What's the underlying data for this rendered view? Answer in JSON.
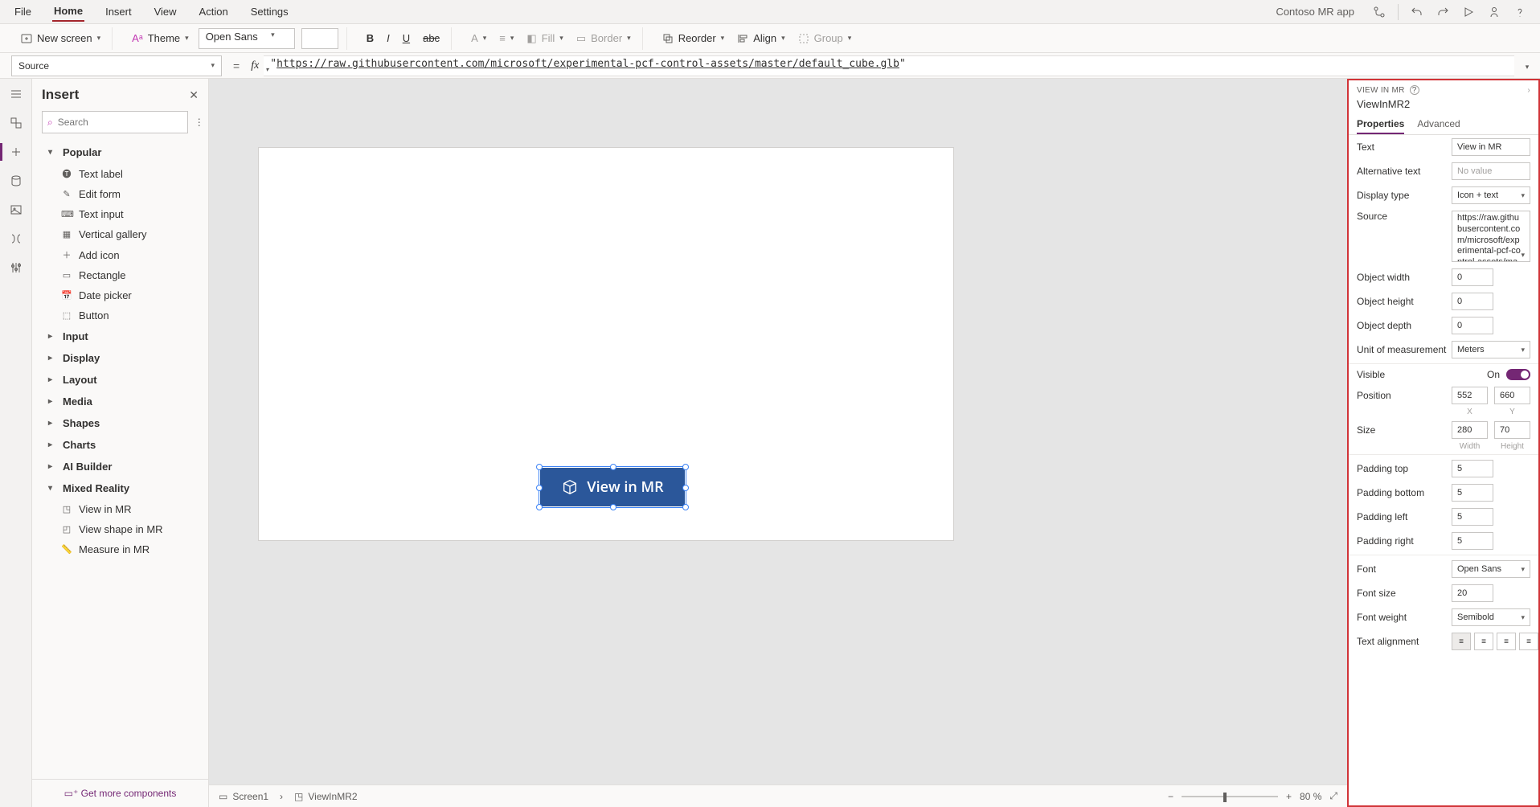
{
  "appName": "Contoso MR app",
  "menu": {
    "file": "File",
    "home": "Home",
    "insert": "Insert",
    "view": "View",
    "action": "Action",
    "settings": "Settings"
  },
  "ribbon": {
    "newScreen": "New screen",
    "theme": "Theme",
    "font": "Open Sans",
    "fontSize": "",
    "fill": "Fill",
    "border": "Border",
    "reorder": "Reorder",
    "align": "Align",
    "group": "Group"
  },
  "formula": {
    "property": "Source",
    "value": "https://raw.githubusercontent.com/microsoft/experimental-pcf-control-assets/master/default_cube.glb"
  },
  "insertPanel": {
    "title": "Insert",
    "searchPlaceholder": "Search",
    "groups": {
      "popular": "Popular",
      "input": "Input",
      "display": "Display",
      "layout": "Layout",
      "media": "Media",
      "shapes": "Shapes",
      "charts": "Charts",
      "aiBuilder": "AI Builder",
      "mixedReality": "Mixed Reality"
    },
    "popularItems": [
      "Text label",
      "Edit form",
      "Text input",
      "Vertical gallery",
      "Add icon",
      "Rectangle",
      "Date picker",
      "Button"
    ],
    "mrItems": [
      "View in MR",
      "View shape in MR",
      "Measure in MR"
    ],
    "getMore": "Get more components"
  },
  "canvas": {
    "btnText": "View in MR",
    "breadcrumbScreen": "Screen1",
    "breadcrumbControl": "ViewInMR2",
    "zoom": "80 %"
  },
  "props": {
    "header": "VIEW IN MR",
    "controlName": "ViewInMR2",
    "tabProperties": "Properties",
    "tabAdvanced": "Advanced",
    "textLabel": "Text",
    "textValue": "View in MR",
    "altLabel": "Alternative text",
    "altPlaceholder": "No value",
    "displayTypeLabel": "Display type",
    "displayTypeValue": "Icon + text",
    "sourceLabel": "Source",
    "sourceValue": "https://raw.githubusercontent.com/microsoft/experimental-pcf-control-assets/master/default_",
    "objWidthLabel": "Object width",
    "objWidthValue": "0",
    "objHeightLabel": "Object height",
    "objHeightValue": "0",
    "objDepthLabel": "Object depth",
    "objDepthValue": "0",
    "unitLabel": "Unit of measurement",
    "unitValue": "Meters",
    "visibleLabel": "Visible",
    "visibleState": "On",
    "positionLabel": "Position",
    "posX": "552",
    "posY": "660",
    "subX": "X",
    "subY": "Y",
    "sizeLabel": "Size",
    "sizeW": "280",
    "sizeH": "70",
    "subW": "Width",
    "subH": "Height",
    "padTopLabel": "Padding top",
    "padTop": "5",
    "padBottomLabel": "Padding bottom",
    "padBottom": "5",
    "padLeftLabel": "Padding left",
    "padLeft": "5",
    "padRightLabel": "Padding right",
    "padRight": "5",
    "fontLabel": "Font",
    "fontValue": "Open Sans",
    "fontSizeLabel": "Font size",
    "fontSizeValue": "20",
    "fontWeightLabel": "Font weight",
    "fontWeightValue": "Semibold",
    "textAlignLabel": "Text alignment"
  }
}
